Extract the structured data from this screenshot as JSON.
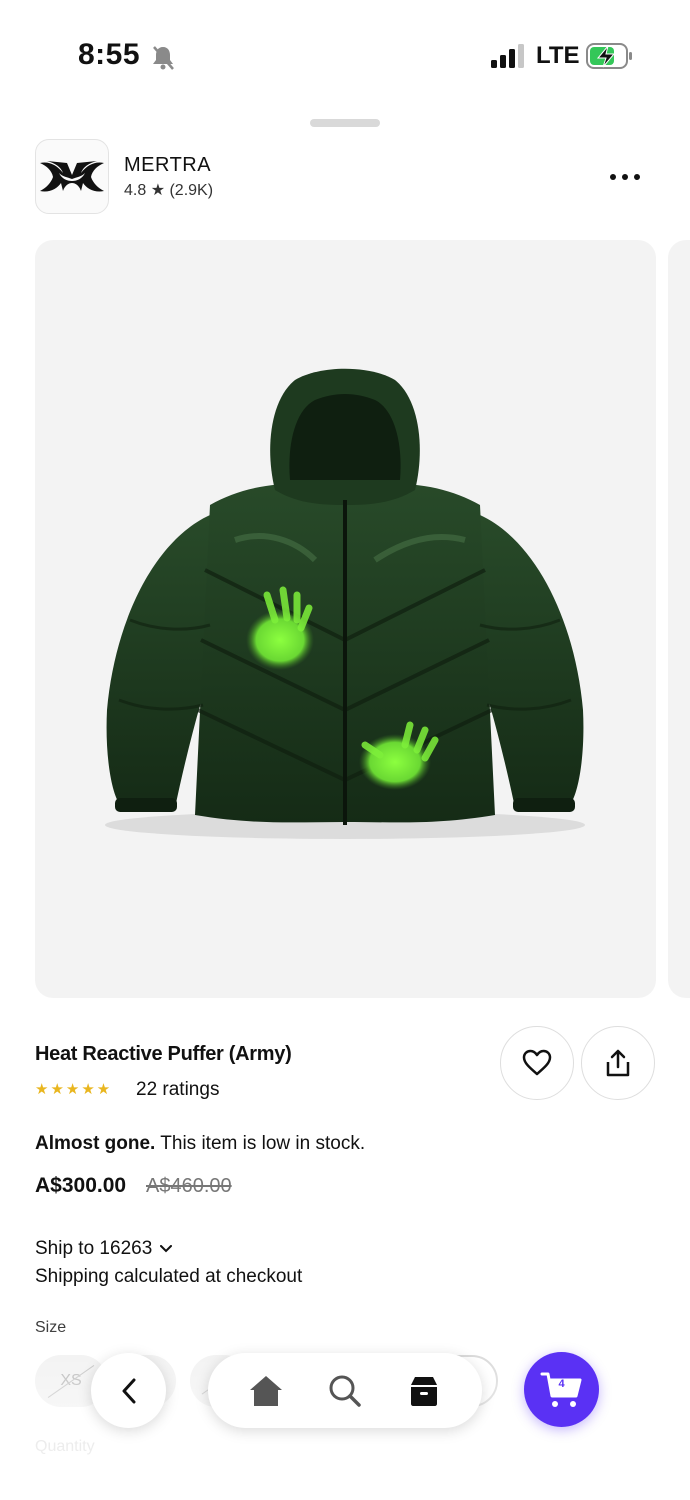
{
  "status_bar": {
    "time": "8:55",
    "network": "LTE",
    "icons": [
      "bell-slash-icon",
      "signal-icon",
      "battery-charging-icon"
    ]
  },
  "store": {
    "name": "MERTRA",
    "rating": "4.8 ★ (2.9K)",
    "logo_icon": "mertra-logo"
  },
  "product": {
    "image": "green-puffer-jacket-with-neon-handprints",
    "title": "Heat Reactive Puffer (Army)",
    "stars": "★★★★★",
    "ratings": "22 ratings",
    "stock_bold": "Almost gone.",
    "stock_text": " This item is low in stock.",
    "price": "A$300.00",
    "compare_price": "A$460.00"
  },
  "shipping": {
    "ship_to": "Ship to 16263",
    "note": "Shipping calculated at checkout"
  },
  "options": {
    "size_label": "Size",
    "sizes": [
      "XS"
    ],
    "quantity_label": "Quantity"
  },
  "nav": {
    "cart_count": "4",
    "icons": [
      "back-chevron-icon",
      "home-icon",
      "search-icon",
      "orders-box-icon",
      "cart-icon"
    ]
  },
  "colors": {
    "accent": "#5a31f4",
    "star": "#e9b61f",
    "jacket": "#1f3a20",
    "print": "#7ef03a"
  }
}
